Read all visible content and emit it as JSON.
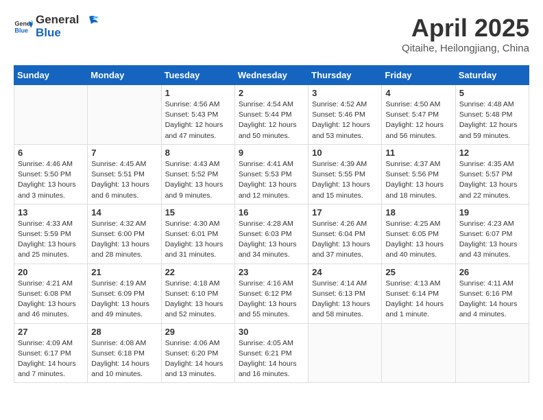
{
  "header": {
    "logo_general": "General",
    "logo_blue": "Blue",
    "month_year": "April 2025",
    "location": "Qitaihe, Heilongjiang, China"
  },
  "weekdays": [
    "Sunday",
    "Monday",
    "Tuesday",
    "Wednesday",
    "Thursday",
    "Friday",
    "Saturday"
  ],
  "weeks": [
    [
      {
        "day": "",
        "info": ""
      },
      {
        "day": "",
        "info": ""
      },
      {
        "day": "1",
        "info": "Sunrise: 4:56 AM\nSunset: 5:43 PM\nDaylight: 12 hours and 47 minutes."
      },
      {
        "day": "2",
        "info": "Sunrise: 4:54 AM\nSunset: 5:44 PM\nDaylight: 12 hours and 50 minutes."
      },
      {
        "day": "3",
        "info": "Sunrise: 4:52 AM\nSunset: 5:46 PM\nDaylight: 12 hours and 53 minutes."
      },
      {
        "day": "4",
        "info": "Sunrise: 4:50 AM\nSunset: 5:47 PM\nDaylight: 12 hours and 56 minutes."
      },
      {
        "day": "5",
        "info": "Sunrise: 4:48 AM\nSunset: 5:48 PM\nDaylight: 12 hours and 59 minutes."
      }
    ],
    [
      {
        "day": "6",
        "info": "Sunrise: 4:46 AM\nSunset: 5:50 PM\nDaylight: 13 hours and 3 minutes."
      },
      {
        "day": "7",
        "info": "Sunrise: 4:45 AM\nSunset: 5:51 PM\nDaylight: 13 hours and 6 minutes."
      },
      {
        "day": "8",
        "info": "Sunrise: 4:43 AM\nSunset: 5:52 PM\nDaylight: 13 hours and 9 minutes."
      },
      {
        "day": "9",
        "info": "Sunrise: 4:41 AM\nSunset: 5:53 PM\nDaylight: 13 hours and 12 minutes."
      },
      {
        "day": "10",
        "info": "Sunrise: 4:39 AM\nSunset: 5:55 PM\nDaylight: 13 hours and 15 minutes."
      },
      {
        "day": "11",
        "info": "Sunrise: 4:37 AM\nSunset: 5:56 PM\nDaylight: 13 hours and 18 minutes."
      },
      {
        "day": "12",
        "info": "Sunrise: 4:35 AM\nSunset: 5:57 PM\nDaylight: 13 hours and 22 minutes."
      }
    ],
    [
      {
        "day": "13",
        "info": "Sunrise: 4:33 AM\nSunset: 5:59 PM\nDaylight: 13 hours and 25 minutes."
      },
      {
        "day": "14",
        "info": "Sunrise: 4:32 AM\nSunset: 6:00 PM\nDaylight: 13 hours and 28 minutes."
      },
      {
        "day": "15",
        "info": "Sunrise: 4:30 AM\nSunset: 6:01 PM\nDaylight: 13 hours and 31 minutes."
      },
      {
        "day": "16",
        "info": "Sunrise: 4:28 AM\nSunset: 6:03 PM\nDaylight: 13 hours and 34 minutes."
      },
      {
        "day": "17",
        "info": "Sunrise: 4:26 AM\nSunset: 6:04 PM\nDaylight: 13 hours and 37 minutes."
      },
      {
        "day": "18",
        "info": "Sunrise: 4:25 AM\nSunset: 6:05 PM\nDaylight: 13 hours and 40 minutes."
      },
      {
        "day": "19",
        "info": "Sunrise: 4:23 AM\nSunset: 6:07 PM\nDaylight: 13 hours and 43 minutes."
      }
    ],
    [
      {
        "day": "20",
        "info": "Sunrise: 4:21 AM\nSunset: 6:08 PM\nDaylight: 13 hours and 46 minutes."
      },
      {
        "day": "21",
        "info": "Sunrise: 4:19 AM\nSunset: 6:09 PM\nDaylight: 13 hours and 49 minutes."
      },
      {
        "day": "22",
        "info": "Sunrise: 4:18 AM\nSunset: 6:10 PM\nDaylight: 13 hours and 52 minutes."
      },
      {
        "day": "23",
        "info": "Sunrise: 4:16 AM\nSunset: 6:12 PM\nDaylight: 13 hours and 55 minutes."
      },
      {
        "day": "24",
        "info": "Sunrise: 4:14 AM\nSunset: 6:13 PM\nDaylight: 13 hours and 58 minutes."
      },
      {
        "day": "25",
        "info": "Sunrise: 4:13 AM\nSunset: 6:14 PM\nDaylight: 14 hours and 1 minute."
      },
      {
        "day": "26",
        "info": "Sunrise: 4:11 AM\nSunset: 6:16 PM\nDaylight: 14 hours and 4 minutes."
      }
    ],
    [
      {
        "day": "27",
        "info": "Sunrise: 4:09 AM\nSunset: 6:17 PM\nDaylight: 14 hours and 7 minutes."
      },
      {
        "day": "28",
        "info": "Sunrise: 4:08 AM\nSunset: 6:18 PM\nDaylight: 14 hours and 10 minutes."
      },
      {
        "day": "29",
        "info": "Sunrise: 4:06 AM\nSunset: 6:20 PM\nDaylight: 14 hours and 13 minutes."
      },
      {
        "day": "30",
        "info": "Sunrise: 4:05 AM\nSunset: 6:21 PM\nDaylight: 14 hours and 16 minutes."
      },
      {
        "day": "",
        "info": ""
      },
      {
        "day": "",
        "info": ""
      },
      {
        "day": "",
        "info": ""
      }
    ]
  ]
}
